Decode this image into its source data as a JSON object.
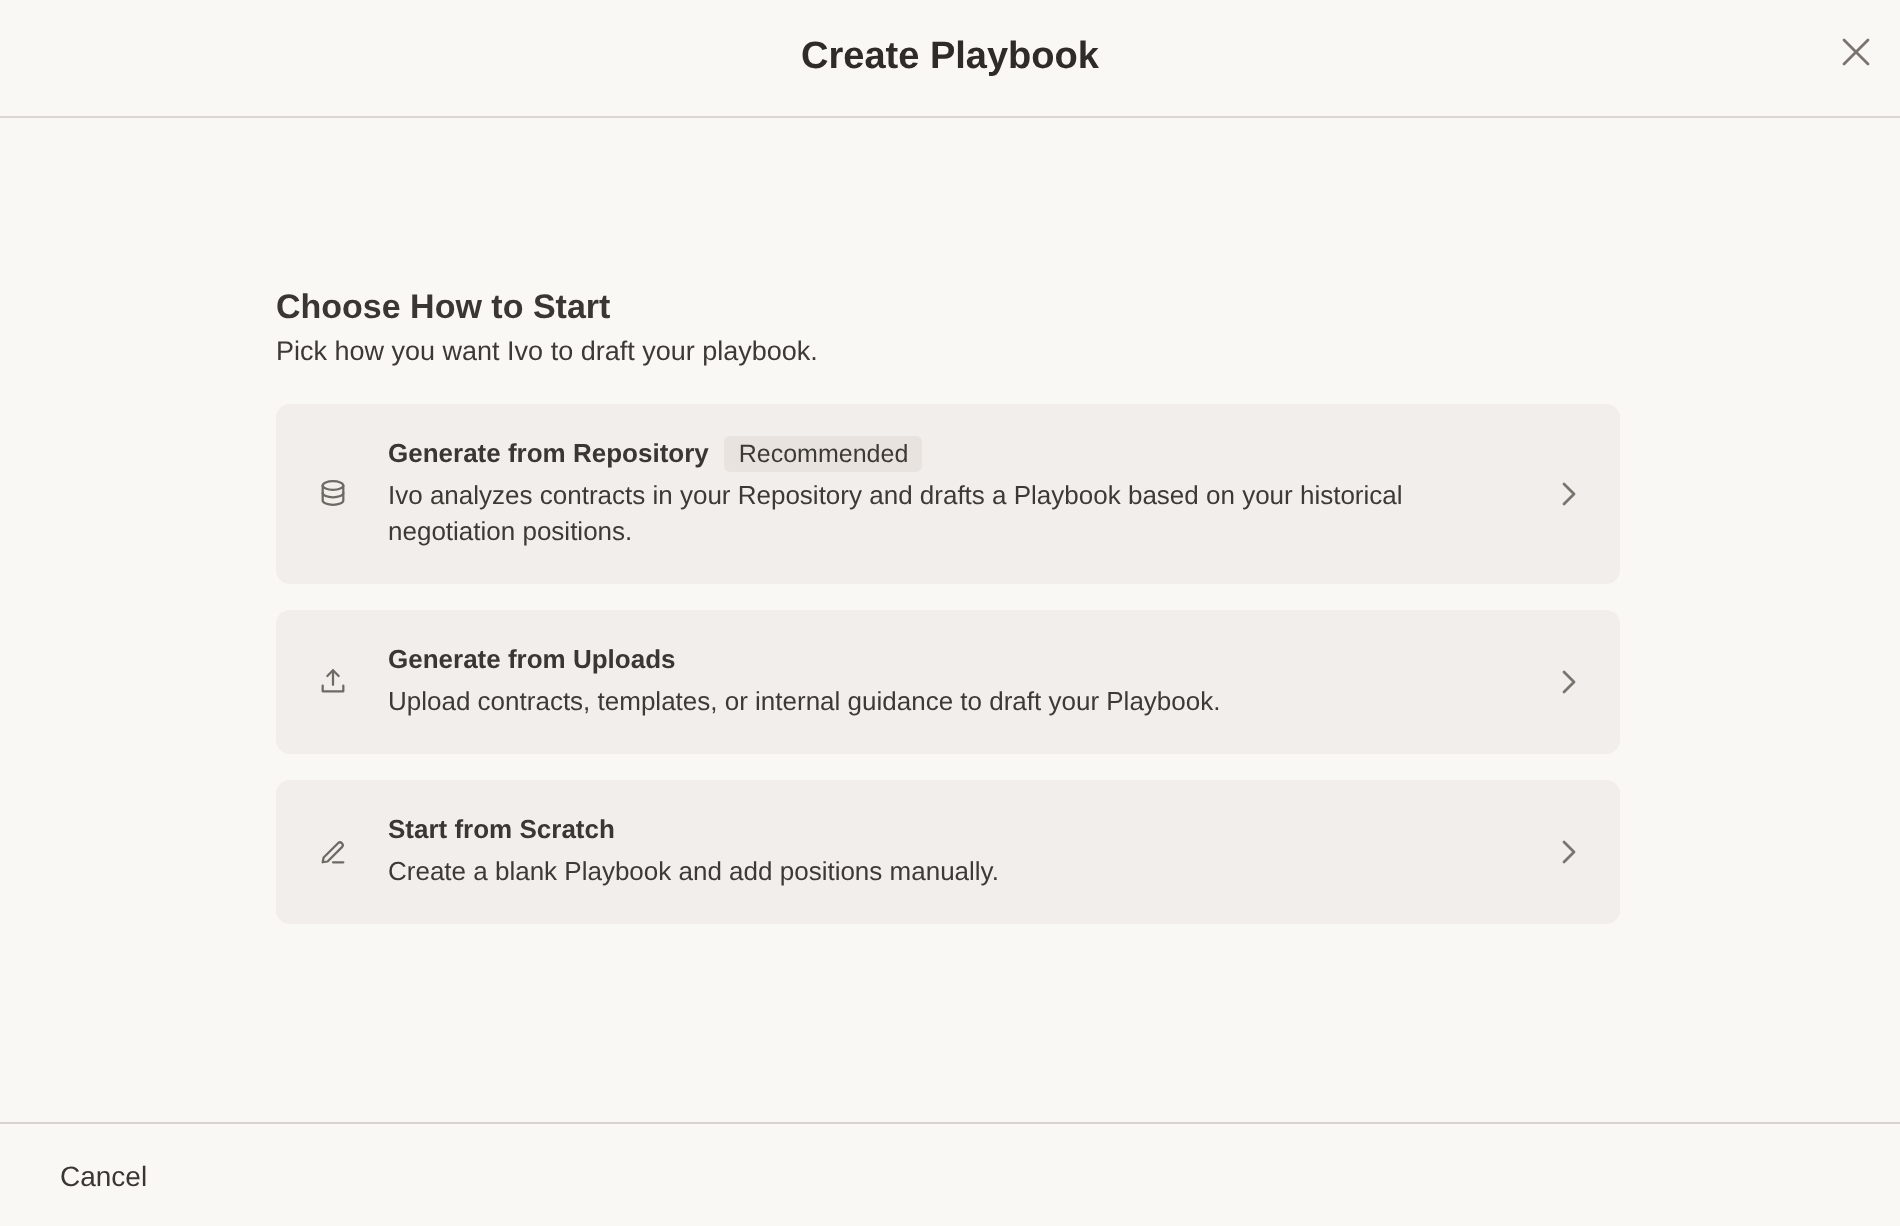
{
  "dialog": {
    "title": "Create Playbook"
  },
  "section": {
    "heading": "Choose How to Start",
    "subtitle": "Pick how you want Ivo to draft your playbook."
  },
  "options": [
    {
      "kind": "repository",
      "title": "Generate from Repository",
      "badge": "Recommended",
      "description": "Ivo analyzes contracts in your Repository and drafts a Playbook based on your historical negotiation positions."
    },
    {
      "kind": "uploads",
      "title": "Generate from Uploads",
      "description": "Upload contracts, templates, or internal guidance to draft your Playbook."
    },
    {
      "kind": "scratch",
      "title": "Start from Scratch",
      "description": "Create a blank Playbook and add positions manually."
    }
  ],
  "footer": {
    "cancel": "Cancel"
  }
}
